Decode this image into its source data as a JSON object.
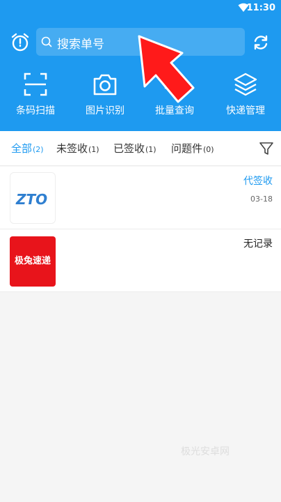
{
  "status_bar": {
    "time": "11:30",
    "wifi_icon": "wifi-icon"
  },
  "header": {
    "search_placeholder": "搜索单号",
    "alarm_icon": "alarm-clock-icon",
    "refresh_icon": "refresh-icon"
  },
  "tools": [
    {
      "label": "条码扫描",
      "icon": "scan-frame-icon"
    },
    {
      "label": "图片识别",
      "icon": "camera-icon"
    },
    {
      "label": "批量查询",
      "icon": "batch-query-icon"
    },
    {
      "label": "快递管理",
      "icon": "layers-icon"
    }
  ],
  "tabs": [
    {
      "label": "全部",
      "count": "(2)"
    },
    {
      "label": "未签收",
      "count": "(1)"
    },
    {
      "label": "已签收",
      "count": "(1)"
    },
    {
      "label": "问题件",
      "count": "(0)"
    }
  ],
  "list": [
    {
      "logo_text": "ZTO",
      "status": "代签收",
      "date": "03-18"
    },
    {
      "logo_text": "极兔速递",
      "status": "无记录"
    }
  ],
  "watermark": "极光安卓网",
  "colors": {
    "primary": "#1e9af0",
    "jitu_red": "#e8141b",
    "arrow_red": "#ff1a1a"
  }
}
